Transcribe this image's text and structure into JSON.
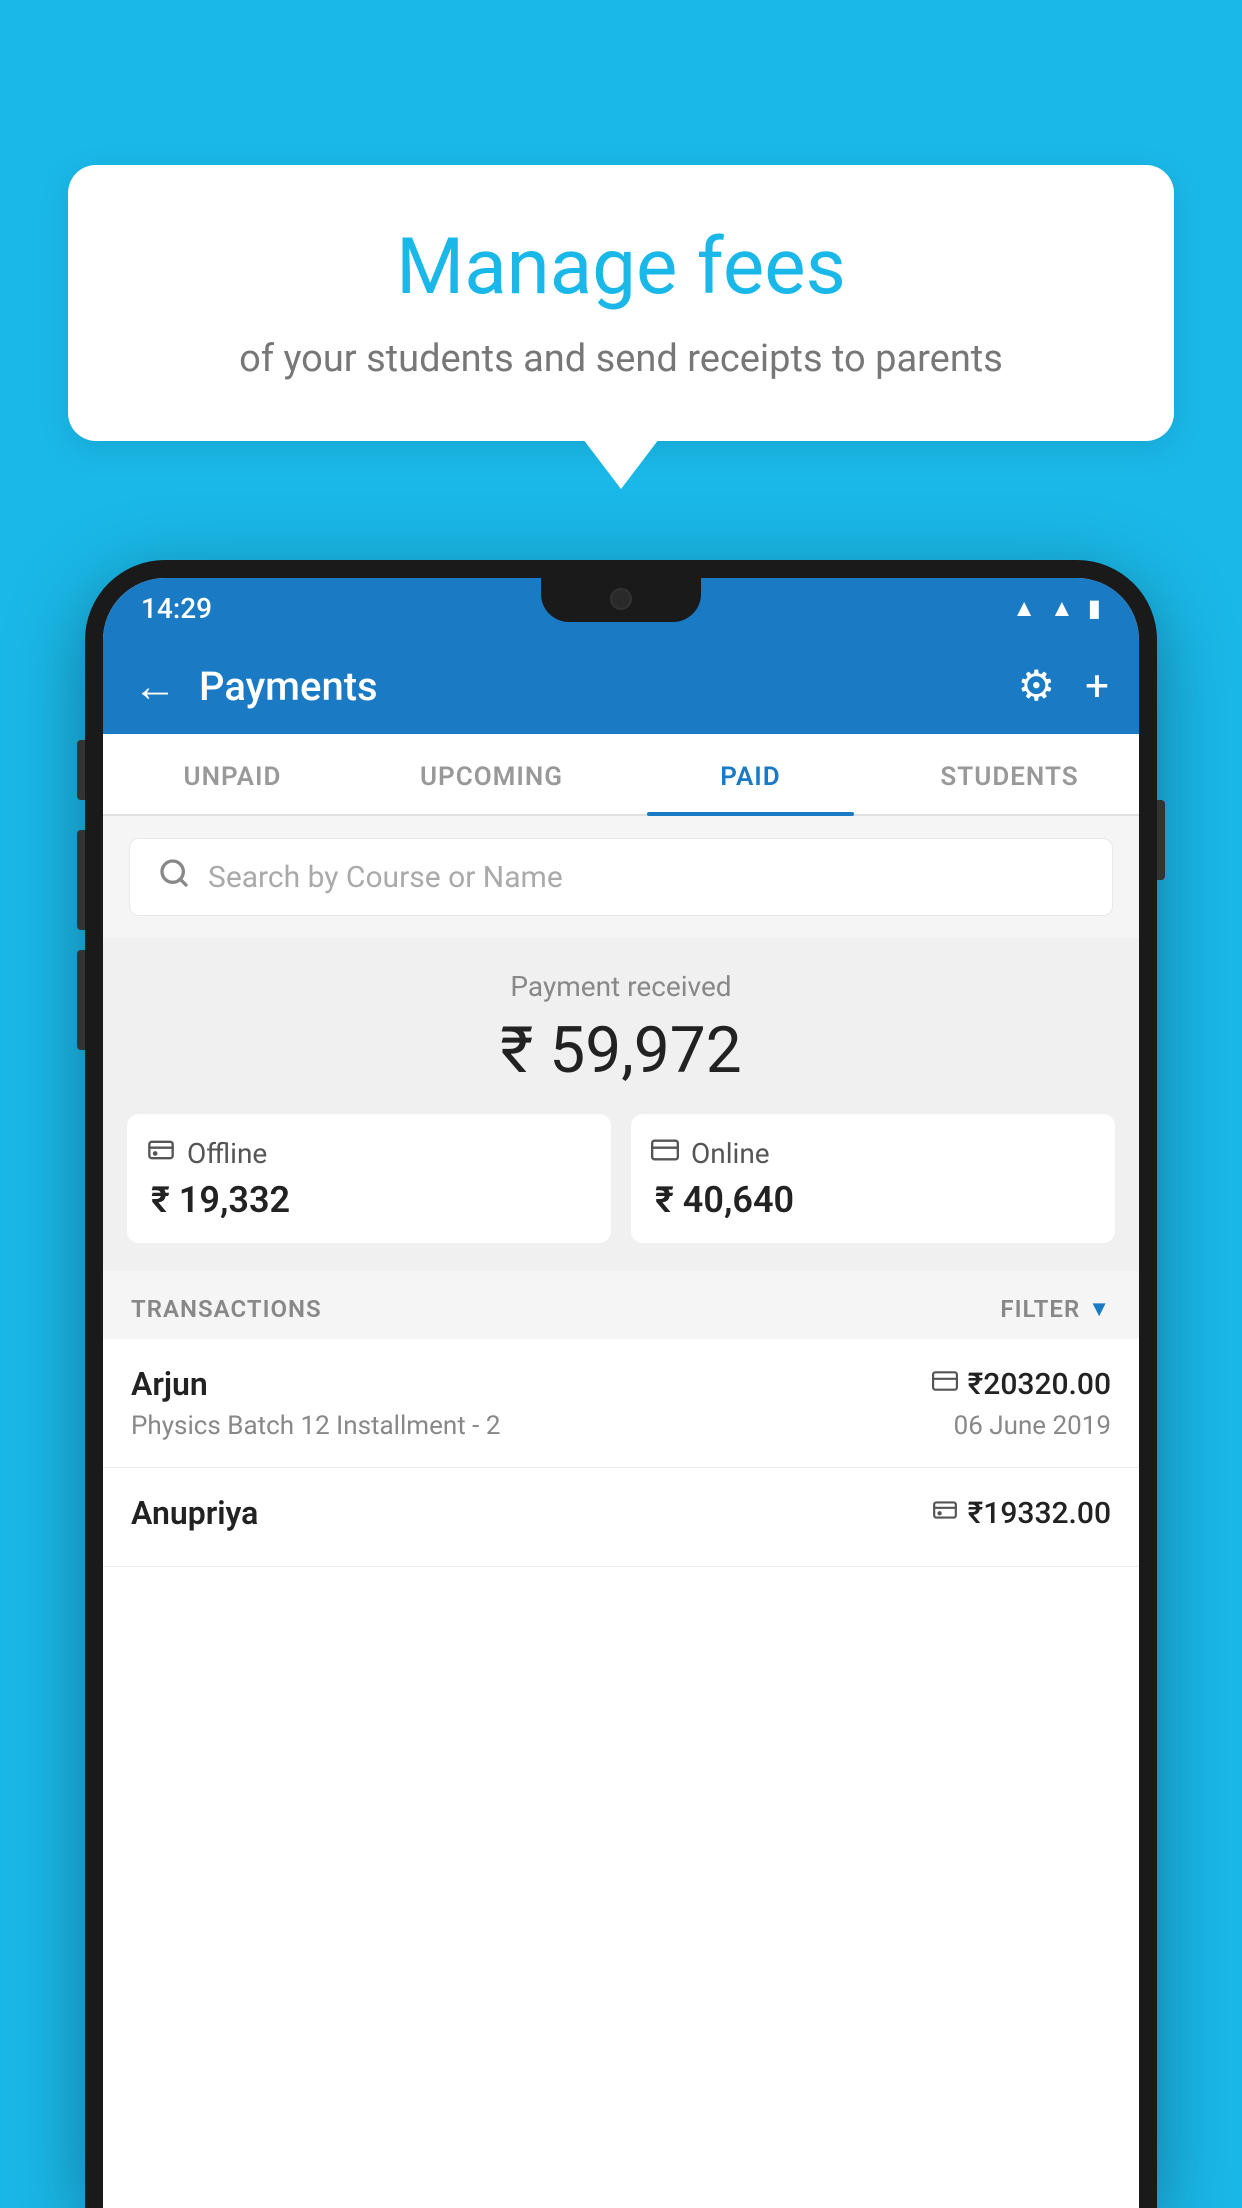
{
  "background_color": "#1ab8e8",
  "tooltip": {
    "title": "Manage fees",
    "subtitle": "of your students and send receipts to parents"
  },
  "status_bar": {
    "time": "14:29",
    "icons": [
      "wifi",
      "signal",
      "battery"
    ]
  },
  "app_bar": {
    "title": "Payments",
    "back_label": "←",
    "settings_label": "⚙",
    "add_label": "+"
  },
  "tabs": [
    {
      "label": "UNPAID",
      "active": false
    },
    {
      "label": "UPCOMING",
      "active": false
    },
    {
      "label": "PAID",
      "active": true
    },
    {
      "label": "STUDENTS",
      "active": false
    }
  ],
  "search": {
    "placeholder": "Search by Course or Name"
  },
  "payment_summary": {
    "received_label": "Payment received",
    "total_amount": "₹ 59,972",
    "offline_label": "Offline",
    "offline_amount": "₹ 19,332",
    "online_label": "Online",
    "online_amount": "₹ 40,640"
  },
  "transactions": {
    "header_label": "TRANSACTIONS",
    "filter_label": "FILTER",
    "items": [
      {
        "name": "Arjun",
        "course": "Physics Batch 12 Installment - 2",
        "amount": "₹20320.00",
        "date": "06 June 2019",
        "payment_type": "online"
      },
      {
        "name": "Anupriya",
        "course": "",
        "amount": "₹19332.00",
        "date": "",
        "payment_type": "offline"
      }
    ]
  }
}
